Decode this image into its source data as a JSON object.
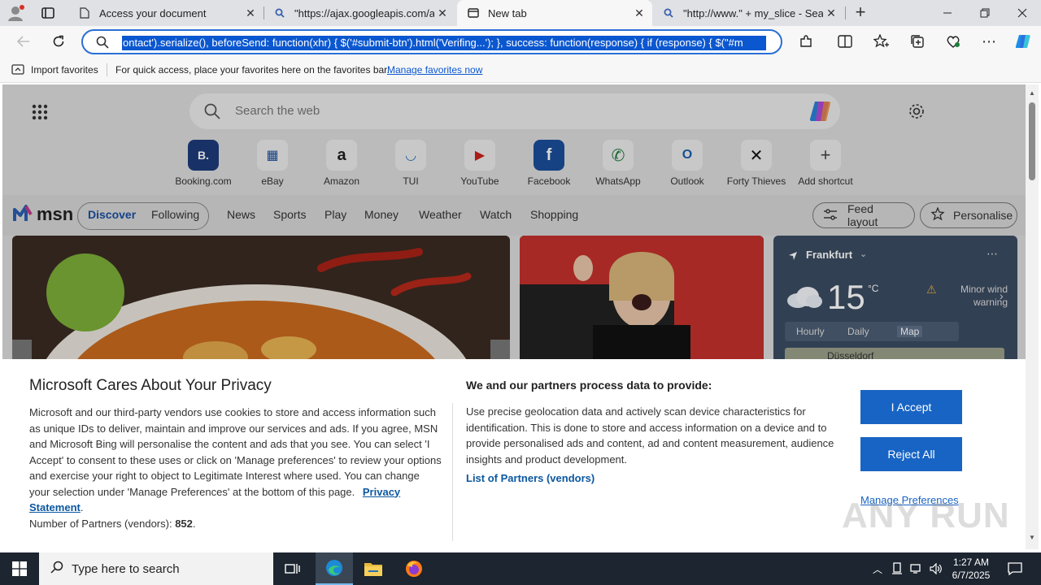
{
  "tabs": [
    {
      "label": "Access your document",
      "icon": "document-icon"
    },
    {
      "label": "\"https://ajax.googleapis.com/aja",
      "icon": "search-icon"
    },
    {
      "label": "New tab",
      "icon": "newtab-icon"
    },
    {
      "label": "\"http://www.\" + my_slice - Searc",
      "icon": "search-icon"
    }
  ],
  "address_bar": {
    "url": "ontact').serialize(), beforeSend: function(xhr) { $('#submit-btn').html('Verifing...'); }, success: function(response) { if (response) { $(\"#m"
  },
  "favorites_bar": {
    "import_label": "Import favorites",
    "message": "For quick access, place your favorites here on the favorites bar.",
    "manage_link": "Manage favorites now"
  },
  "newtab": {
    "search_placeholder": "Search the web",
    "shortcuts": [
      {
        "label": "Booking.com",
        "glyph": "B."
      },
      {
        "label": "eBay",
        "glyph": "▦"
      },
      {
        "label": "Amazon",
        "glyph": "a"
      },
      {
        "label": "TUI",
        "glyph": "◡"
      },
      {
        "label": "YouTube",
        "glyph": "▶"
      },
      {
        "label": "Facebook",
        "glyph": "f"
      },
      {
        "label": "WhatsApp",
        "glyph": "✆"
      },
      {
        "label": "Outlook",
        "glyph": "O"
      },
      {
        "label": "Forty Thieves",
        "glyph": "✕"
      },
      {
        "label": "Add shortcut",
        "glyph": "+"
      }
    ]
  },
  "msn": {
    "logo": "msn",
    "tabs": [
      "Discover",
      "Following"
    ],
    "nav": [
      "News",
      "Sports",
      "Play",
      "Money",
      "Weather",
      "Watch",
      "Shopping"
    ],
    "feed_layout": "Feed layout",
    "personalise": "Personalise"
  },
  "weather": {
    "city": "Frankfurt",
    "temp": "15",
    "unit": "°C",
    "warning": "Minor wind warning",
    "tabs": [
      "Hourly",
      "Daily",
      "Map"
    ],
    "map_city": "Düsseldorf"
  },
  "privacy": {
    "title": "Microsoft Cares About Your Privacy",
    "body": "Microsoft and our third-party vendors use cookies to store and access information such as unique IDs to deliver, maintain and improve our services and ads. If you agree, MSN and Microsoft Bing will personalise the content and ads that you see. You can select 'I Accept' to consent to these uses or click on 'Manage preferences' to review your options and exercise your right to object to Legitimate Interest where used.  You can change your selection under 'Manage Preferences' at the bottom of this page.",
    "privacy_link": "Privacy Statement",
    "partners_label": "Number of Partners (vendors):",
    "partners_count": "852",
    "process_title": "We and our partners process data to provide:",
    "process_body": "Use precise geolocation data and actively scan device characteristics for identification. This is done to store and access information on a device and to provide personalised ads and content, ad and content measurement, audience insights and product development.",
    "partners_link": "List of Partners (vendors)",
    "accept": "I Accept",
    "reject": "Reject All",
    "manage": "Manage Preferences"
  },
  "taskbar": {
    "search_placeholder": "Type here to search",
    "time": "1:27 AM",
    "date": "6/7/2025"
  },
  "watermark": "ANY RUN"
}
